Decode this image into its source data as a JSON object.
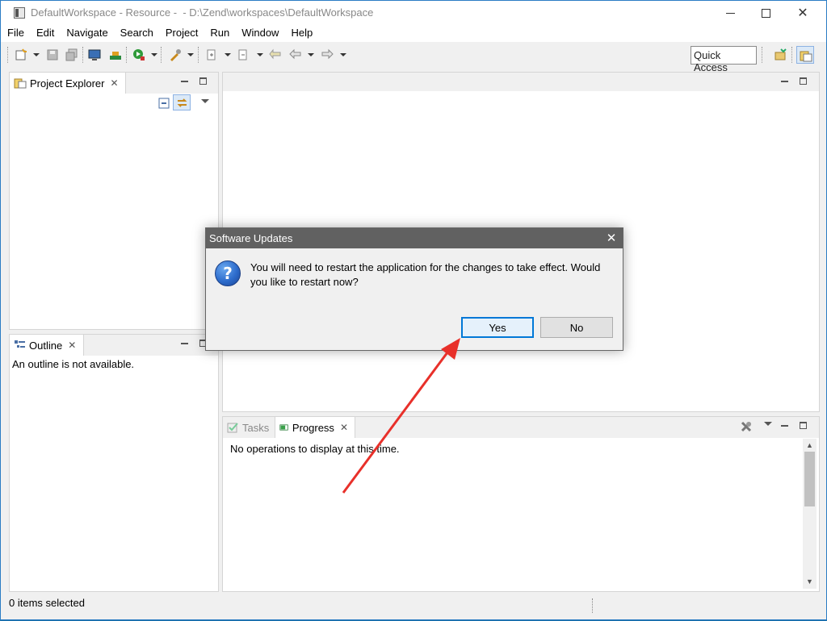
{
  "window": {
    "title": "DefaultWorkspace - Resource -  - D:\\Zend\\workspaces\\DefaultWorkspace"
  },
  "menu": [
    "File",
    "Edit",
    "Navigate",
    "Search",
    "Project",
    "Run",
    "Window",
    "Help"
  ],
  "toolbar": {
    "quick_access": "Quick Access"
  },
  "project_explorer": {
    "tab_label": "Project Explorer"
  },
  "outline": {
    "tab_label": "Outline",
    "message": "An outline is not available."
  },
  "bottom_panel": {
    "tasks_label": "Tasks",
    "progress_label": "Progress",
    "message": "No operations to display at this time."
  },
  "status": {
    "text": "0 items selected"
  },
  "dialog": {
    "title": "Software Updates",
    "message": "You will need to restart the application for the changes to take effect. Would you like to restart now?",
    "yes_label": "Yes",
    "no_label": "No"
  },
  "colors": {
    "accent": "#0078d7",
    "dialog_title_bg": "#616161",
    "annotation_arrow": "#e8302a"
  }
}
